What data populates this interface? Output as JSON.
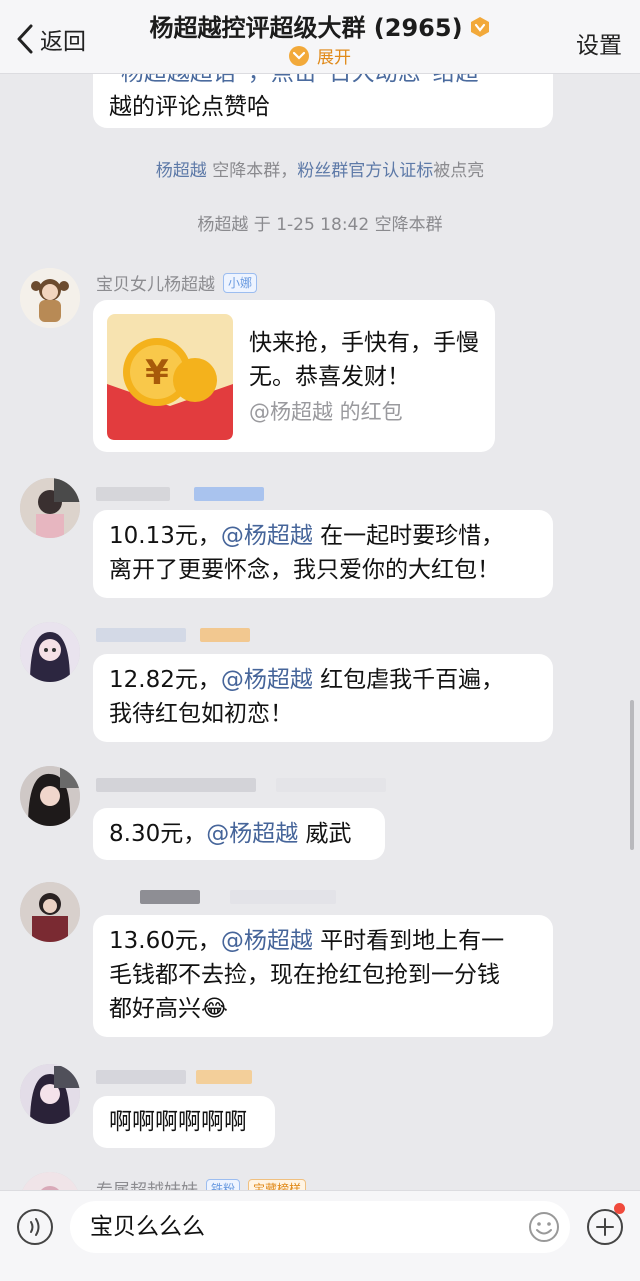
{
  "header": {
    "back_label": "返回",
    "title": "杨超越控评超级大群 (2965)",
    "expand_label": "展开",
    "settings_label": "设置"
  },
  "messages": {
    "top_bubble": {
      "line1": "“杨超越超话”，点击“日大动态”给超",
      "line2": "越的评论点赞哈"
    },
    "system1": {
      "name": "杨超越",
      "text1": " 空降本群，",
      "link": "粉丝群官方认证标",
      "text2": "被点亮"
    },
    "system2": "杨超越 于 1-25 18:42 空降本群",
    "packet_msg": {
      "nick": "宝贝女儿杨超越",
      "tag": "小娜",
      "text": "快来抢，手快有，手慢无。恭喜发财！",
      "sub": "@杨超越 的红包"
    },
    "m1": {
      "amount": "10.13元，",
      "mention": "@杨超越",
      "line1_rest": " 在一起时要珍惜，",
      "line2": "离开了更要怀念，我只爱你的大红包！"
    },
    "m2": {
      "amount": "12.82元，",
      "mention": "@杨超越",
      "line1_rest": " 红包虐我千百遍，",
      "line2": "我待红包如初恋！"
    },
    "m3": {
      "amount": "8.30元，",
      "mention": "@杨超越",
      "rest": " 威武"
    },
    "m4": {
      "amount": "13.60元，",
      "mention": "@杨超越",
      "line1_rest": " 平时看到地上有一",
      "line2": "毛钱都不去捡，现在抢红包抢到一分钱",
      "line3": "都好高兴",
      "emoji": "😂"
    },
    "m5": {
      "text": "啊啊啊啊啊啊"
    },
    "partial": {
      "nick": "专属超越妹妹",
      "tag1": "铁粉",
      "tag2": "宝藏榜样"
    }
  },
  "input": {
    "value": "宝贝么么么"
  },
  "colors": {
    "accent": "#e08a1a",
    "mention": "#46659a",
    "packet_red": "#e23c3e",
    "badge": "#f04a3c"
  },
  "icons": [
    "chevron-left-icon",
    "verified-badge-icon",
    "chevron-down-icon",
    "red-packet-icon",
    "voice-icon",
    "emoji-icon",
    "plus-icon"
  ]
}
